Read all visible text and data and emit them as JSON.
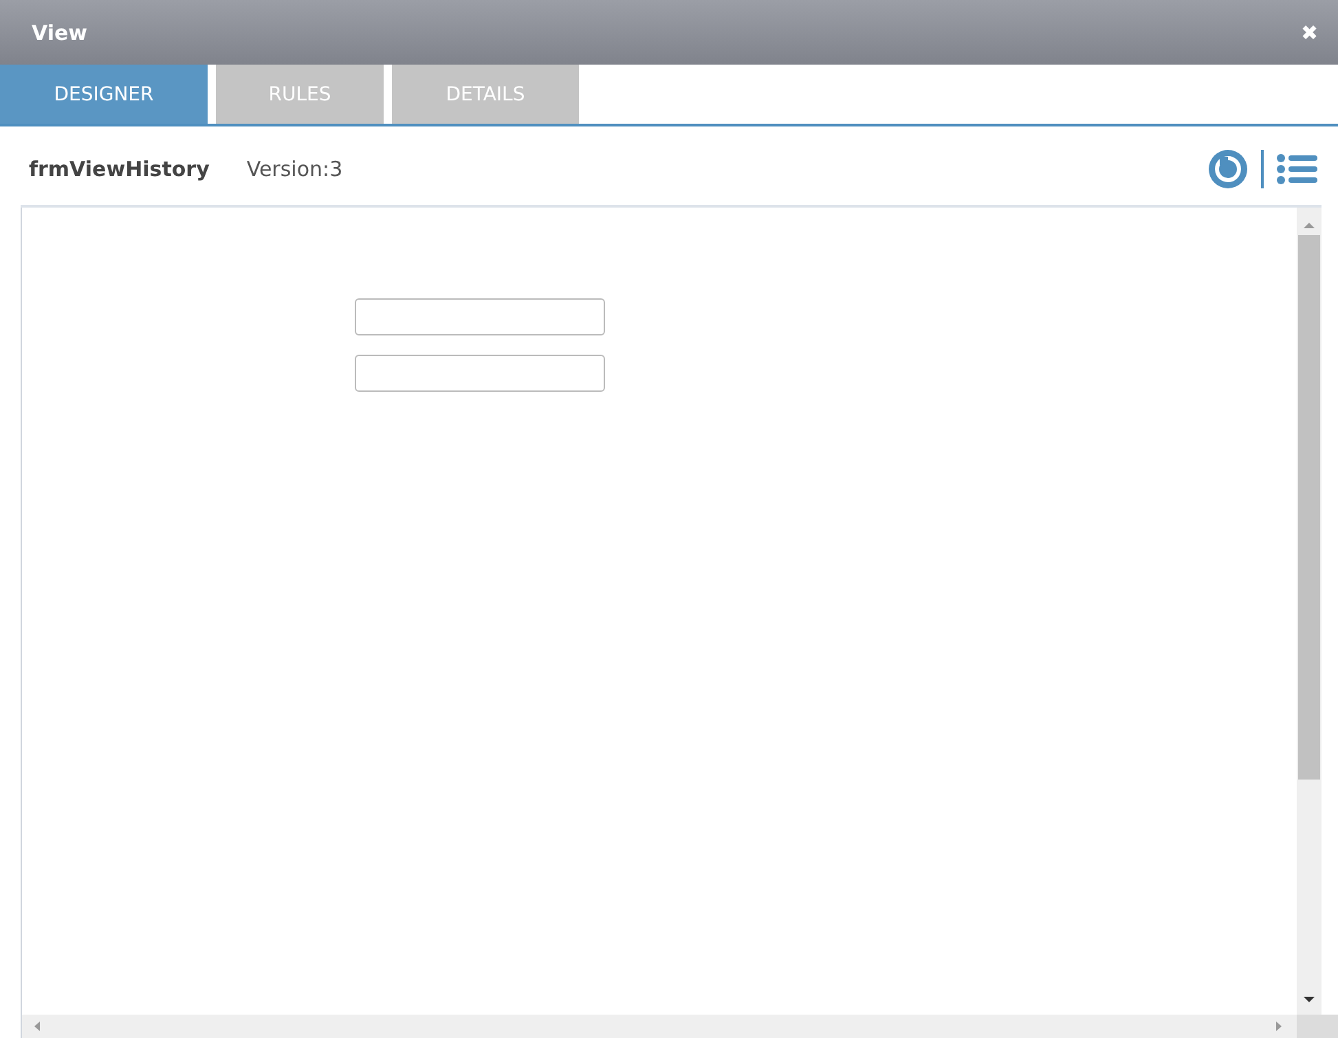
{
  "window": {
    "title": "View",
    "close": "✖"
  },
  "tabs": [
    {
      "label": "DESIGNER",
      "selected": true
    },
    {
      "label": "RULES",
      "selected": false
    },
    {
      "label": "DETAILS",
      "selected": false
    }
  ],
  "form": {
    "name": "frmViewHistory",
    "version": "Version:3"
  },
  "canvas": {
    "fields": [
      {
        "kind": "textbox"
      },
      {
        "kind": "textbox"
      }
    ]
  }
}
